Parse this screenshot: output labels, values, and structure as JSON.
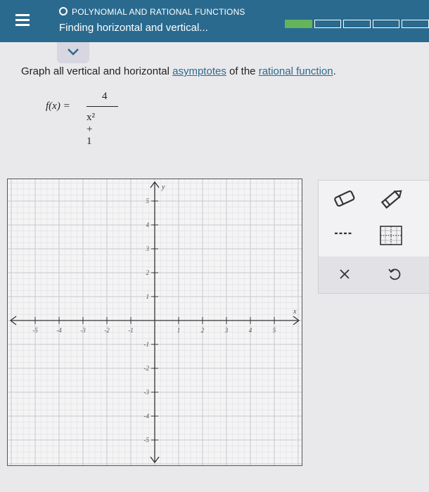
{
  "header": {
    "topic": "POLYNOMIAL AND RATIONAL FUNCTIONS",
    "title": "Finding horizontal and vertical...",
    "progress_segments": [
      true,
      false,
      false,
      false,
      false
    ]
  },
  "question": {
    "prefix": "Graph all vertical and horizontal ",
    "link1": "asymptotes",
    "middle": " of the ",
    "link2": "rational function",
    "suffix": "."
  },
  "formula": {
    "lhs": "f(x) =",
    "numerator": "4",
    "denominator": "x² + 1"
  },
  "graph": {
    "x_label": "x",
    "y_label": "y",
    "x_tick_labels": [
      "-5",
      "-4",
      "-3",
      "-2",
      "-1",
      "1",
      "2",
      "3",
      "4",
      "5"
    ],
    "y_tick_labels": [
      "5",
      "4",
      "3",
      "2",
      "1",
      "-1",
      "-2",
      "-3",
      "-4",
      "-5"
    ]
  },
  "colors": {
    "header": "#2a6a8e",
    "progress_fill": "#64b45b",
    "link": "#2a6a8e"
  },
  "tools": [
    "eraser-icon",
    "pencil-icon",
    "dashed-line-icon",
    "asymptote-grid-icon",
    "clear-icon",
    "undo-icon"
  ]
}
